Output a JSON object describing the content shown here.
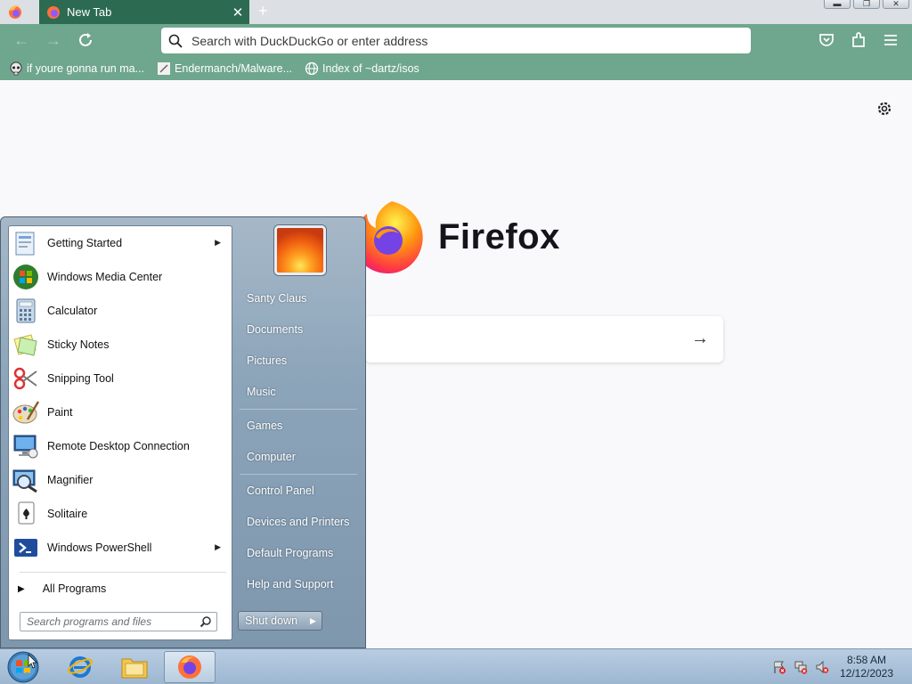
{
  "browser": {
    "tab_title": "New Tab",
    "tab_close": "✕",
    "new_tab": "+",
    "url_placeholder": "Search with DuckDuckGo or enter address",
    "bookmarks": [
      {
        "label": "if youre gonna run ma...",
        "icon": "skull-icon"
      },
      {
        "label": "Endermanch/Malware...",
        "icon": "github-page-icon"
      },
      {
        "label": "Index of ~dartz/isos",
        "icon": "globe-icon"
      }
    ]
  },
  "page": {
    "wordmark": "Firefox",
    "search_arrow": "→"
  },
  "start_menu": {
    "programs": [
      {
        "label": "Getting Started",
        "icon": "getting-started-icon",
        "submenu": true
      },
      {
        "label": "Windows Media Center",
        "icon": "media-center-icon",
        "submenu": false
      },
      {
        "label": "Calculator",
        "icon": "calculator-icon",
        "submenu": false
      },
      {
        "label": "Sticky Notes",
        "icon": "sticky-notes-icon",
        "submenu": false
      },
      {
        "label": "Snipping Tool",
        "icon": "scissors-icon",
        "submenu": false
      },
      {
        "label": "Paint",
        "icon": "paint-palette-icon",
        "submenu": false
      },
      {
        "label": "Remote Desktop Connection",
        "icon": "remote-desktop-icon",
        "submenu": false
      },
      {
        "label": "Magnifier",
        "icon": "magnifier-icon",
        "submenu": false
      },
      {
        "label": "Solitaire",
        "icon": "cards-icon",
        "submenu": false
      },
      {
        "label": "Windows PowerShell",
        "icon": "powershell-icon",
        "submenu": true
      }
    ],
    "all_programs": "All Programs",
    "search_placeholder": "Search programs and files",
    "right_items": [
      "Santy Claus",
      "Documents",
      "Pictures",
      "Music",
      "Games",
      "Computer",
      "Control Panel",
      "Devices and Printers",
      "Default Programs",
      "Help and Support"
    ],
    "shutdown_label": "Shut down"
  },
  "taskbar": {
    "time": "8:58 AM",
    "date": "12/12/2023"
  }
}
